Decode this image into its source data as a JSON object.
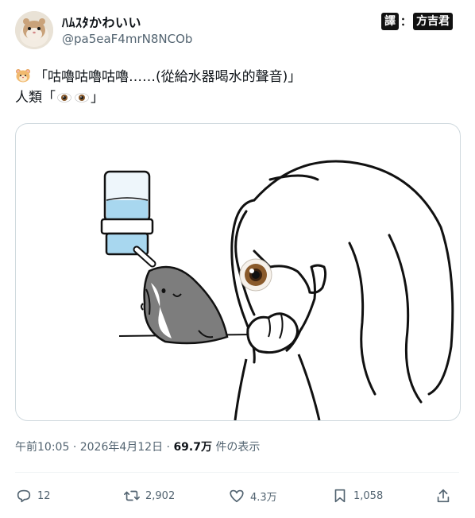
{
  "user": {
    "display_name": "ﾊﾑｽﾀかわいい",
    "handle": "@pa5eaF4mrN8NCOb"
  },
  "translator_stamp": {
    "left": "譯",
    "separator": "：",
    "right": "方吉君"
  },
  "tweet": {
    "line1_text": "「咕嚕咕嚕咕嚕……(從給水器喝水的聲音)」",
    "line2_prefix": "人類「",
    "line2_suffix": "」",
    "hamster_emoji": "hamster-face",
    "eye_emoji": "eye"
  },
  "meta": {
    "time": "午前10:05",
    "dot": "·",
    "date": "2026年4月12日",
    "views_count": "69.7万",
    "views_label": "件の表示"
  },
  "actions": {
    "replies": "12",
    "reposts": "2,902",
    "likes": "4.3万",
    "bookmarks": "1,058"
  },
  "colors": {
    "text_primary": "#0f1419",
    "text_secondary": "#536471",
    "border": "#cfd9de"
  }
}
